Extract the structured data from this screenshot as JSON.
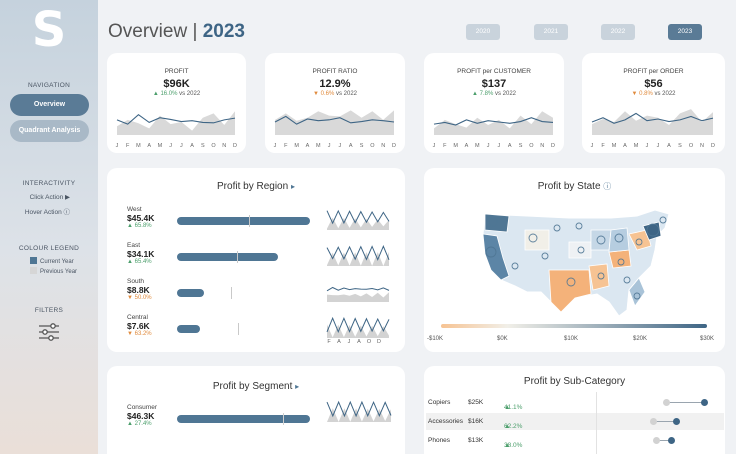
{
  "logo": "S",
  "sidebar": {
    "navigation_heading": "NAVIGATION",
    "nav": [
      {
        "label": "Overview",
        "active": true
      },
      {
        "label": "Quadrant Analysis",
        "active": false
      }
    ],
    "interactivity_heading": "INTERACTIVITY",
    "click_action": "Click Action ▶",
    "hover_action": "Hover Action ⓘ",
    "legend_heading": "COLOUR LEGEND",
    "legend": [
      {
        "label": "Current Year",
        "color": "#4f7694"
      },
      {
        "label": "Previous Year",
        "color": "#d6d6d6"
      }
    ],
    "filters_heading": "FILTERS"
  },
  "header": {
    "title": "Overview | ",
    "year": "2023"
  },
  "year_buttons": [
    {
      "label": "2020",
      "selected": false
    },
    {
      "label": "2021",
      "selected": false
    },
    {
      "label": "2022",
      "selected": false
    },
    {
      "label": "2023",
      "selected": true
    }
  ],
  "kpis": [
    {
      "label": "PROFIT",
      "value": "$96K",
      "arrow": "▲",
      "change": "16.0%",
      "vs": " vs 2022",
      "direction": "up",
      "current": [
        40,
        30,
        52,
        34,
        45,
        41,
        36,
        38,
        34,
        33,
        40,
        44
      ],
      "previous": [
        25,
        40,
        32,
        20,
        50,
        30,
        35,
        15,
        45,
        55,
        28,
        60
      ]
    },
    {
      "label": "PROFIT RATIO",
      "value": "12.9%",
      "arrow": "▼",
      "change": "0.6%",
      "vs": " vs 2022",
      "direction": "down",
      "current": [
        35,
        48,
        30,
        42,
        38,
        40,
        45,
        33,
        36,
        40,
        38,
        35
      ],
      "previous": [
        40,
        55,
        38,
        45,
        60,
        50,
        48,
        62,
        45,
        60,
        40,
        62
      ]
    },
    {
      "label": "PROFIT per CUSTOMER",
      "value": "$137",
      "arrow": "▲",
      "change": "7.8%",
      "vs": " vs 2022",
      "direction": "up",
      "current": [
        30,
        34,
        28,
        40,
        32,
        38,
        35,
        32,
        36,
        45,
        36,
        34
      ],
      "previous": [
        20,
        40,
        30,
        22,
        45,
        28,
        40,
        20,
        50,
        30,
        60,
        45
      ]
    },
    {
      "label": "PROFIT per ORDER",
      "value": "$56",
      "arrow": "▼",
      "change": "0.8%",
      "vs": " vs 2022",
      "direction": "down",
      "current": [
        35,
        45,
        32,
        40,
        55,
        38,
        42,
        36,
        40,
        48,
        38,
        44
      ],
      "previous": [
        30,
        42,
        35,
        60,
        38,
        50,
        45,
        28,
        55,
        65,
        35,
        58
      ]
    }
  ],
  "month_labels": [
    "J",
    "F",
    "M",
    "A",
    "M",
    "J",
    "J",
    "A",
    "S",
    "O",
    "N",
    "D"
  ],
  "region_chart": {
    "title": "Profit by Region",
    "title_icon": "▸",
    "regions": [
      {
        "name": "West",
        "value": "$45.4K",
        "arrow": "▲",
        "change": "65.8%",
        "direction": "up",
        "share": 0.98,
        "prev_share": 0.53
      },
      {
        "name": "East",
        "value": "$34.1K",
        "arrow": "▲",
        "change": "65.4%",
        "direction": "up",
        "share": 0.74,
        "prev_share": 0.44
      },
      {
        "name": "South",
        "value": "$8.8K",
        "arrow": "▼",
        "change": "50.0%",
        "direction": "down",
        "share": 0.2,
        "prev_share": 0.4
      },
      {
        "name": "Central",
        "value": "$7.6K",
        "arrow": "▼",
        "change": "63.2%",
        "direction": "down",
        "share": 0.17,
        "prev_share": 0.45
      }
    ],
    "axis": [
      "F",
      "A",
      "J",
      "A",
      "O",
      "D"
    ]
  },
  "state_chart": {
    "title": "Profit by State",
    "title_icon": "ⓘ",
    "scale_labels": [
      "-$10K",
      "$0K",
      "$10K",
      "$20K",
      "$30K"
    ],
    "scale_colors": [
      "#f6c393",
      "#f1efe8",
      "#3e6585"
    ]
  },
  "segment_chart": {
    "title": "Profit by Segment",
    "title_icon": "▸",
    "segments": [
      {
        "name": "Consumer",
        "value": "$46.3K",
        "arrow": "▲",
        "change": "27.4%",
        "direction": "up",
        "share": 0.98,
        "prev_share": 0.78
      }
    ]
  },
  "subcategory_chart": {
    "title": "Profit by Sub-Category",
    "rows": [
      {
        "name": "Copiers",
        "value": "$25K",
        "arrow": "▲",
        "change": "41.1%",
        "direction": "up",
        "prev": 0.5,
        "cur": 0.88
      },
      {
        "name": "Accessories",
        "value": "$16K",
        "arrow": "▲",
        "change": "62.2%",
        "direction": "up",
        "prev": 0.37,
        "cur": 0.6
      },
      {
        "name": "Phones",
        "value": "$13K",
        "arrow": "▲",
        "change": "38.0%",
        "direction": "up",
        "prev": 0.4,
        "cur": 0.55
      }
    ]
  }
}
